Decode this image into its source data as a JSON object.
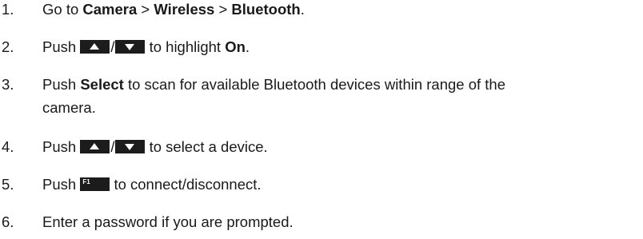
{
  "steps": [
    {
      "number": "1.",
      "lines": [
        {
          "segments": [
            {
              "type": "text",
              "value": "Go to "
            },
            {
              "type": "bold",
              "value": "Camera"
            },
            {
              "type": "text",
              "value": " > "
            },
            {
              "type": "bold",
              "value": "Wireless"
            },
            {
              "type": "text",
              "value": " > "
            },
            {
              "type": "bold",
              "value": "Bluetooth"
            },
            {
              "type": "text",
              "value": "."
            }
          ]
        }
      ]
    },
    {
      "number": "2.",
      "lines": [
        {
          "segments": [
            {
              "type": "text",
              "value": "Push "
            },
            {
              "type": "key",
              "icon": "arrow-up-key-icon"
            },
            {
              "type": "text",
              "value": "/"
            },
            {
              "type": "key",
              "icon": "arrow-down-key-icon"
            },
            {
              "type": "text",
              "value": " to highlight "
            },
            {
              "type": "bold",
              "value": "On"
            },
            {
              "type": "text",
              "value": "."
            }
          ]
        }
      ]
    },
    {
      "number": "3.",
      "lines": [
        {
          "segments": [
            {
              "type": "text",
              "value": "Push "
            },
            {
              "type": "bold",
              "value": "Select"
            },
            {
              "type": "text",
              "value": " to scan for available Bluetooth devices within range of the"
            }
          ]
        },
        {
          "segments": [
            {
              "type": "text",
              "value": "camera."
            }
          ]
        }
      ]
    },
    {
      "number": "4.",
      "lines": [
        {
          "segments": [
            {
              "type": "text",
              "value": "Push "
            },
            {
              "type": "key",
              "icon": "arrow-up-key-icon"
            },
            {
              "type": "text",
              "value": "/"
            },
            {
              "type": "key",
              "icon": "arrow-down-key-icon"
            },
            {
              "type": "text",
              "value": " to select a device."
            }
          ]
        }
      ]
    },
    {
      "number": "5.",
      "lines": [
        {
          "segments": [
            {
              "type": "text",
              "value": "Push "
            },
            {
              "type": "key",
              "icon": "f1-key-icon",
              "label": "F1"
            },
            {
              "type": "text",
              "value": " to connect/disconnect."
            }
          ]
        }
      ]
    },
    {
      "number": "6.",
      "lines": [
        {
          "segments": [
            {
              "type": "text",
              "value": "Enter a password if you are prompted."
            }
          ]
        }
      ]
    }
  ]
}
